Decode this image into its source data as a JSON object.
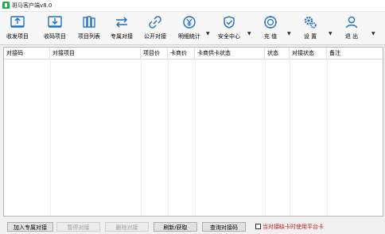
{
  "window": {
    "title": "斑马客户端v8.0"
  },
  "toolbar": {
    "items": [
      {
        "label": "收发项目",
        "icon": "inbox-send-icon"
      },
      {
        "label": "收码项目",
        "icon": "inbox-receive-icon"
      },
      {
        "label": "项目列表",
        "icon": "book-list-icon"
      },
      {
        "label": "专属对接",
        "icon": "exchange-arrows-icon"
      },
      {
        "label": "公开对接",
        "icon": "link-chain-icon"
      },
      {
        "label": "明细统计",
        "icon": "yuan-circle-icon"
      },
      {
        "label": "安全中心",
        "icon": "shield-icon"
      },
      {
        "label": "充 值",
        "icon": "recharge-icon"
      },
      {
        "label": "设 置",
        "icon": "gears-icon"
      },
      {
        "label": "退 出",
        "icon": "user-icon"
      }
    ]
  },
  "table": {
    "columns": [
      "对接码",
      "对接项目",
      "项目价",
      "卡商价",
      "卡商供卡状态",
      "状态",
      "对接状态",
      "备注"
    ],
    "rows": []
  },
  "bottom": {
    "add_exclusive": "加入专属对接",
    "pause": "暂停对接",
    "delete": "删除对接",
    "refresh": "刷新/获取",
    "query": "查询对接码",
    "platform_card": "当对接缺卡时使用平台卡"
  },
  "colors": {
    "accent": "#1b6fc2",
    "warning_text": "#d01818"
  }
}
